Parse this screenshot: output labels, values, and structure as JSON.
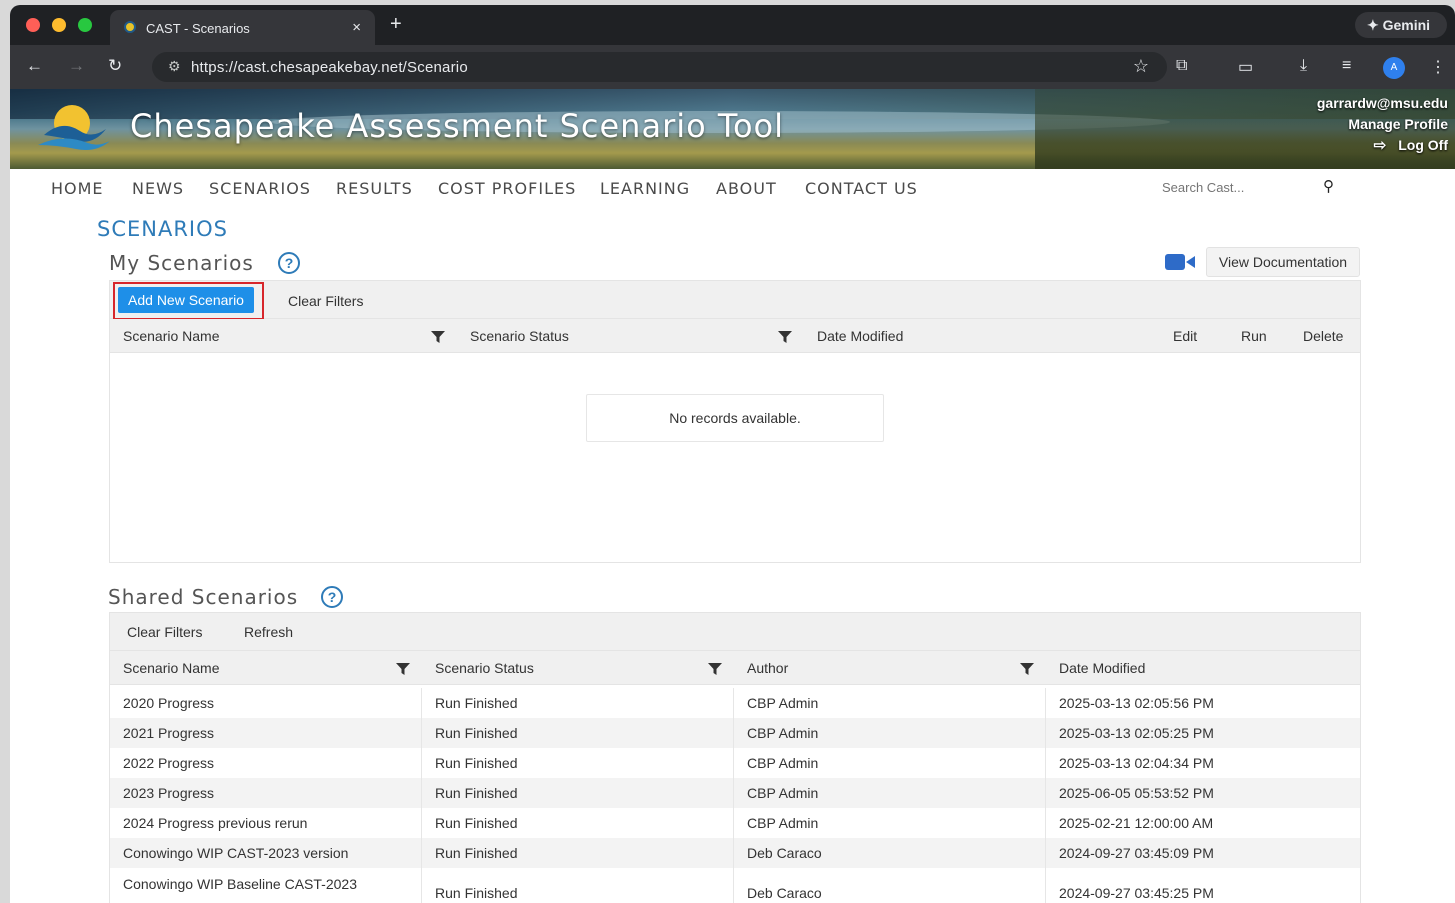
{
  "browser": {
    "tab_title": "CAST - Scenarios",
    "tab_close": "×",
    "new_tab": "+",
    "gemini_label": "✦ Gemini",
    "url": "https://cast.chesapeakebay.net/Scenario"
  },
  "banner": {
    "title": "Chesapeake Assessment Scenario Tool",
    "user_email": "garrardw@msu.edu",
    "manage_profile": "Manage Profile",
    "log_off": "Log Off"
  },
  "nav": {
    "items": [
      "HOME",
      "NEWS",
      "SCENARIOS",
      "RESULTS",
      "COST PROFILES",
      "LEARNING",
      "ABOUT",
      "CONTACT US"
    ],
    "search_placeholder": "Search Cast..."
  },
  "page": {
    "heading": "SCENARIOS",
    "view_documentation": "View Documentation"
  },
  "my_scenarios": {
    "title": "My Scenarios",
    "add_button": "Add New Scenario",
    "clear_filters": "Clear Filters",
    "columns": [
      "Scenario Name",
      "Scenario Status",
      "Date Modified",
      "Edit",
      "Run",
      "Delete"
    ],
    "empty_message": "No records available."
  },
  "shared_scenarios": {
    "title": "Shared Scenarios",
    "clear_filters": "Clear Filters",
    "refresh": "Refresh",
    "columns": [
      "Scenario Name",
      "Scenario Status",
      "Author",
      "Date Modified"
    ],
    "rows": [
      [
        "2020 Progress",
        "Run Finished",
        "CBP Admin",
        "2025-03-13 02:05:56 PM"
      ],
      [
        "2021 Progress",
        "Run Finished",
        "CBP Admin",
        "2025-03-13 02:05:25 PM"
      ],
      [
        "2022 Progress",
        "Run Finished",
        "CBP Admin",
        "2025-03-13 02:04:34 PM"
      ],
      [
        "2023 Progress",
        "Run Finished",
        "CBP Admin",
        "2025-06-05 05:53:52 PM"
      ],
      [
        "2024 Progress previous rerun",
        "Run Finished",
        "CBP Admin",
        "2025-02-21 12:00:00 AM"
      ],
      [
        "Conowingo WIP CAST-2023 version",
        "Run Finished",
        "Deb Caraco",
        "2024-09-27 03:45:09 PM"
      ],
      [
        "Conowingo WIP Baseline CAST-2023",
        "Run Finished",
        "Deb Caraco",
        "2024-09-27 03:45:25 PM"
      ]
    ]
  },
  "colors": {
    "accent": "#2e7bb8",
    "add_button": "#1e8fe8",
    "highlight": "#d7262b"
  }
}
